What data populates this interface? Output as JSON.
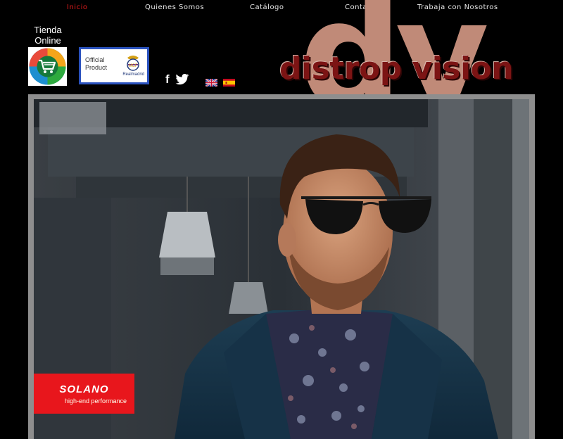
{
  "nav": {
    "items": [
      {
        "label": "Inicio",
        "active": true
      },
      {
        "label": "Quienes Somos",
        "active": false
      },
      {
        "label": "Catálogo",
        "active": false
      },
      {
        "label": "Contacto",
        "active": false
      },
      {
        "label": "Trabaja con Nosotros",
        "active": false
      }
    ]
  },
  "shop": {
    "label_line1": "Tienda",
    "label_line2": "Online",
    "icon": "shopping-cart-icon"
  },
  "partner_badge": {
    "line1": "Official",
    "line2": "Product",
    "brand": "Realmadrid"
  },
  "social": {
    "facebook_glyph": "f",
    "icons": [
      "facebook-icon",
      "twitter-icon"
    ]
  },
  "languages": [
    "english-flag-icon",
    "spanish-flag-icon"
  ],
  "logo": {
    "mark": "dy",
    "name": "distrop vision"
  },
  "hero": {
    "brand_badge": {
      "name": "SOLANO",
      "tagline": "high-end performance",
      "color": "#e8161c"
    }
  },
  "colors": {
    "background": "#000000",
    "nav_active": "#e01b1b",
    "logo_mark": "#c08a78",
    "logo_text": "#7c1414",
    "frame": "#8e8e8e"
  }
}
